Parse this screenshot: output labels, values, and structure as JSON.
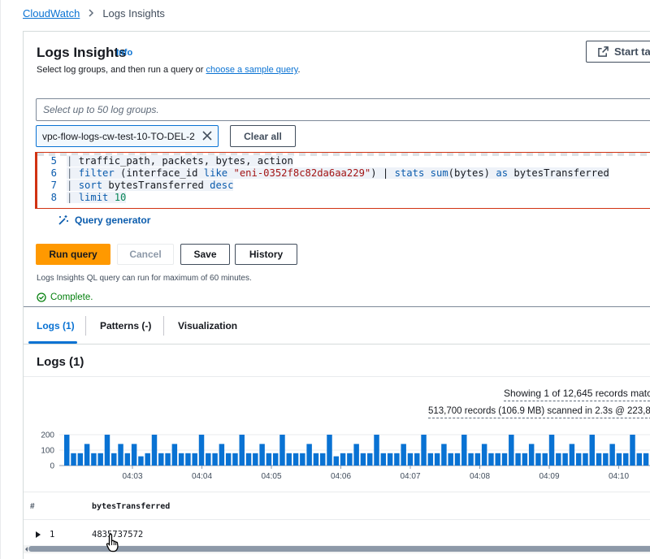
{
  "breadcrumb": {
    "root": "CloudWatch",
    "current": "Logs Insights"
  },
  "header": {
    "title": "Logs Insights",
    "info": "Info",
    "subtitle_pre": "Select log groups, and then run a query or ",
    "subtitle_link": "choose a sample query",
    "subtitle_post": ".",
    "start_button": "Start tai"
  },
  "log_group_select": {
    "placeholder": "Select up to 50 log groups.",
    "selected_token": "vpc-flow-logs-cw-test-10-TO-DEL-2",
    "clear_all": "Clear all"
  },
  "editor": {
    "lines": [
      {
        "num": "5",
        "bar": "| ",
        "text": "traffic_path, packets, bytes, action"
      },
      {
        "num": "6",
        "bar": "| ",
        "kw1": "filter",
        "p1": " (interface_id ",
        "kw2": "like",
        "p2": " ",
        "str": "\"eni-0352f8c82da6aa229\"",
        "p3": ") | ",
        "kw3": "stats",
        "p4": " ",
        "kw4": "sum",
        "p5": "(bytes) ",
        "kw5": "as",
        "p6": " bytesTransferred"
      },
      {
        "num": "7",
        "bar": "| ",
        "kw1": "sort",
        "p1": " bytesTransferred ",
        "kw2": "desc"
      },
      {
        "num": "8",
        "bar": "| ",
        "kw1": "limit",
        "p1": " ",
        "num_val": "10"
      }
    ]
  },
  "query_generator": "Query generator",
  "actions": {
    "run": "Run query",
    "cancel": "Cancel",
    "save": "Save",
    "history": "History"
  },
  "limit_note": "Logs Insights QL query can run for maximum of 60 minutes.",
  "status": "Complete.",
  "tabs": [
    {
      "label": "Logs (1)",
      "active": true
    },
    {
      "label": "Patterns (-)",
      "active": false
    },
    {
      "label": "Visualization",
      "active": false
    }
  ],
  "results": {
    "title": "Logs (1)",
    "showing": "Showing 1 of 12,645 records matc",
    "records": "513,700 records (106.9 MB) scanned in 2.3s @ 223,8"
  },
  "chart_data": {
    "type": "bar",
    "y_ticks": [
      "200",
      "100",
      "0"
    ],
    "ylim": [
      0,
      200
    ],
    "x_ticks": [
      "04:03",
      "04:04",
      "04:05",
      "04:06",
      "04:07",
      "04:08",
      "04:09",
      "04:10"
    ],
    "values": [
      200,
      80,
      80,
      140,
      80,
      80,
      200,
      80,
      140,
      80,
      140,
      60,
      80,
      200,
      80,
      80,
      140,
      80,
      80,
      80,
      200,
      80,
      80,
      140,
      80,
      80,
      200,
      80,
      80,
      140,
      80,
      80,
      200,
      80,
      80,
      80,
      140,
      80,
      80,
      200,
      60,
      80,
      80,
      140,
      80,
      80,
      200,
      80,
      80,
      80,
      140,
      80,
      80,
      200,
      80,
      80,
      140,
      80,
      80,
      200,
      80,
      80,
      140,
      80,
      80,
      80,
      200,
      80,
      80,
      140,
      80,
      80,
      200,
      80,
      80,
      140,
      80,
      80,
      200,
      80,
      80,
      140,
      80,
      80,
      200,
      80,
      80,
      140,
      80,
      80
    ],
    "bar_color": "#0972d3"
  },
  "table": {
    "columns": [
      "#",
      "bytesTransferred"
    ],
    "rows": [
      {
        "num": "1",
        "bytesTransferred": "4835737572"
      }
    ]
  }
}
